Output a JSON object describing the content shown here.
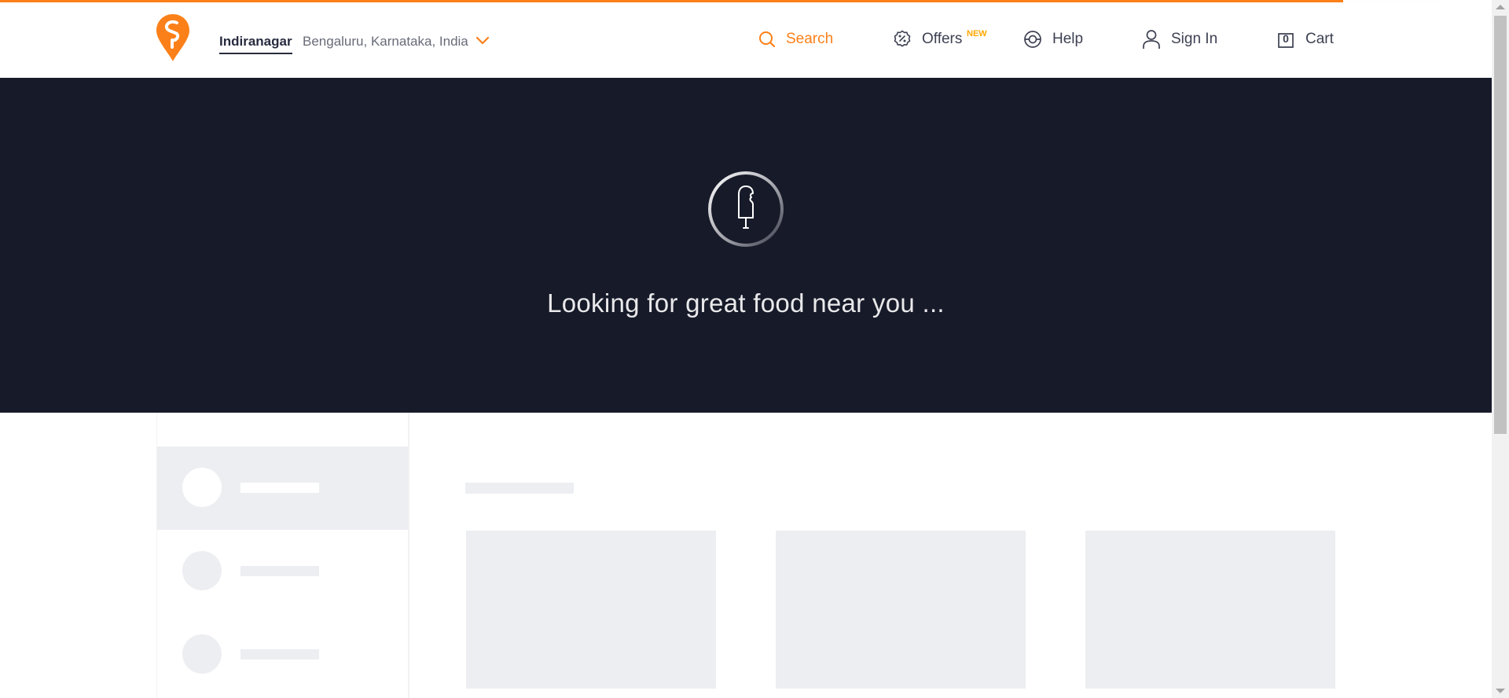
{
  "brand": {
    "name": "Swiggy",
    "color": "#fc8019"
  },
  "location": {
    "primary": "Indiranagar",
    "secondary": "Bengaluru, Karnataka, India",
    "icon": "chevron-down-icon"
  },
  "nav": {
    "search": {
      "label": "Search",
      "icon": "search-icon"
    },
    "offers": {
      "label": "Offers",
      "badge": "NEW",
      "icon": "offers-percent-icon"
    },
    "help": {
      "label": "Help",
      "icon": "lifebuoy-icon"
    },
    "signin": {
      "label": "Sign In",
      "icon": "user-icon"
    },
    "cart": {
      "label": "Cart",
      "count": "0",
      "icon": "cart-bag-icon"
    }
  },
  "hero": {
    "loading_text": "Looking for great food near you ...",
    "icon": "ice-cream-icon",
    "background": "#171a29"
  },
  "skeleton": {
    "sidebar_items": 3,
    "cards": 3
  }
}
